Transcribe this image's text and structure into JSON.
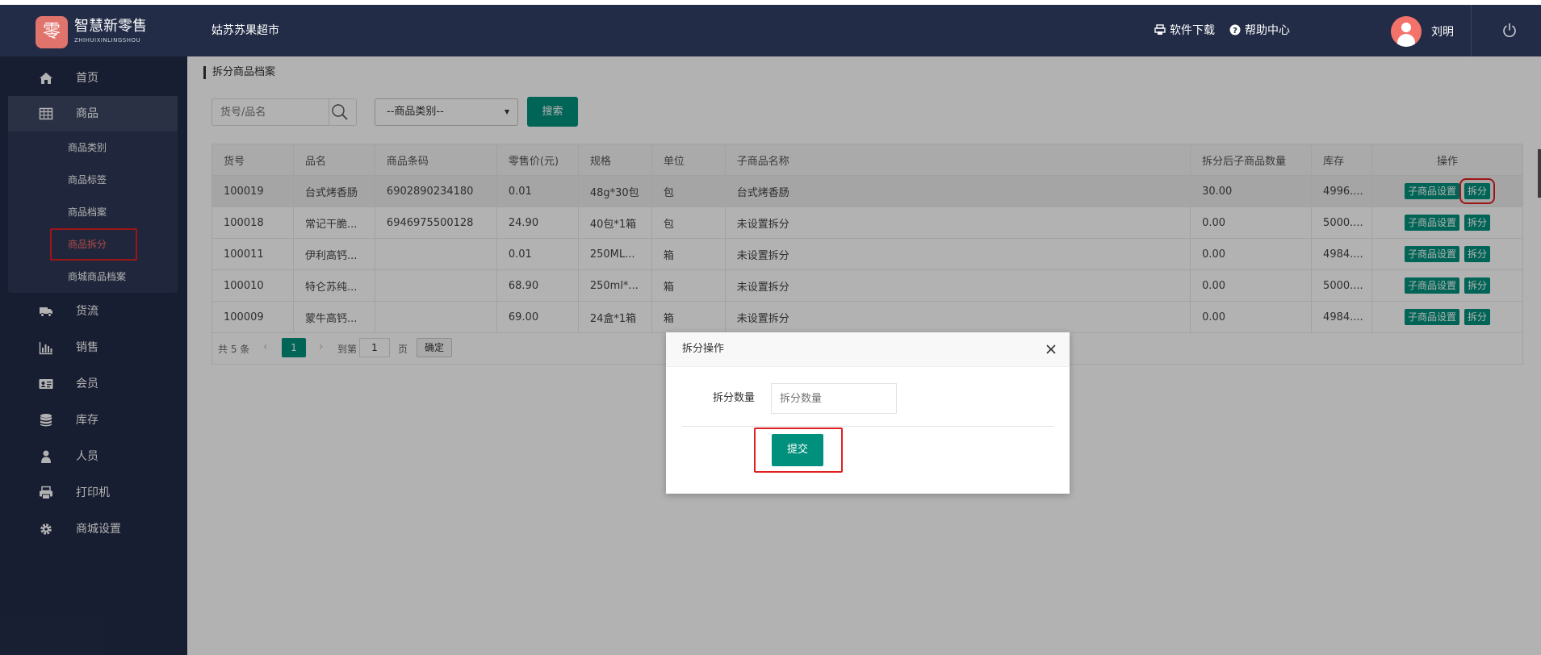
{
  "header": {
    "logo_glyph": "零",
    "logo_title": "智慧新零售",
    "logo_sub": "ZHIHUIXINLINGSHOU",
    "store_name": "姑苏苏果超市",
    "download_label": "软件下载",
    "help_label": "帮助中心",
    "username": "刘明"
  },
  "sidebar": {
    "items": [
      {
        "label": "首页",
        "icon": "home-icon"
      },
      {
        "label": "商品",
        "icon": "grid-table-icon"
      },
      {
        "label": "货流",
        "icon": "truck-icon"
      },
      {
        "label": "销售",
        "icon": "bar-chart-icon"
      },
      {
        "label": "会员",
        "icon": "id-card-icon"
      },
      {
        "label": "库存",
        "icon": "database-icon"
      },
      {
        "label": "人员",
        "icon": "person-icon"
      },
      {
        "label": "打印机",
        "icon": "printer-icon"
      },
      {
        "label": "商城设置",
        "icon": "gear-icon"
      }
    ],
    "sub_items": [
      {
        "label": "商品类别"
      },
      {
        "label": "商品标签"
      },
      {
        "label": "商品档案"
      },
      {
        "label": "商品拆分"
      },
      {
        "label": "商城商品档案"
      }
    ]
  },
  "breadcrumb": "拆分商品档案",
  "search": {
    "placeholder": "货号/品名",
    "category_value": "--商品类别--",
    "button_label": "搜索"
  },
  "table": {
    "columns": [
      "货号",
      "品名",
      "商品条码",
      "零售价(元)",
      "规格",
      "单位",
      "子商品名称",
      "拆分后子商品数量",
      "库存",
      "操作"
    ],
    "rows": [
      {
        "id": "100019",
        "name": "台式烤香肠",
        "barcode": "6902890234180",
        "price": "0.01",
        "spec": "48g*30包",
        "unit": "包",
        "child": "台式烤香肠",
        "qty": "30.00",
        "stock": "4996...."
      },
      {
        "id": "100018",
        "name": "常记干脆...",
        "barcode": "6946975500128",
        "price": "24.90",
        "spec": "40包*1箱",
        "unit": "包",
        "child": "未设置拆分",
        "qty": "0.00",
        "stock": "5000...."
      },
      {
        "id": "100011",
        "name": "伊利高钙...",
        "barcode": "",
        "price": "0.01",
        "spec": "250ML...",
        "unit": "箱",
        "child": "未设置拆分",
        "qty": "0.00",
        "stock": "4984...."
      },
      {
        "id": "100010",
        "name": "特仑苏纯...",
        "barcode": "",
        "price": "68.90",
        "spec": "250ml*...",
        "unit": "箱",
        "child": "未设置拆分",
        "qty": "0.00",
        "stock": "5000...."
      },
      {
        "id": "100009",
        "name": "蒙牛高钙...",
        "barcode": "",
        "price": "69.00",
        "spec": "24盒*1箱",
        "unit": "箱",
        "child": "未设置拆分",
        "qty": "0.00",
        "stock": "4984...."
      }
    ],
    "op_child_label": "子商品设置",
    "op_split_label": "拆分"
  },
  "pager": {
    "total": "共 5 条",
    "prev": "‹",
    "current": "1",
    "next": "›",
    "goto": "到第",
    "page_input": "1",
    "unit": "页",
    "confirm": "确定"
  },
  "modal": {
    "title": "拆分操作",
    "label": "拆分数量",
    "placeholder": "拆分数量",
    "submit": "提交"
  },
  "colors": {
    "accent": "#00907b",
    "nav_bg": "#232c47",
    "highlight": "#e02020",
    "active_sub": "#ff6b6b"
  }
}
